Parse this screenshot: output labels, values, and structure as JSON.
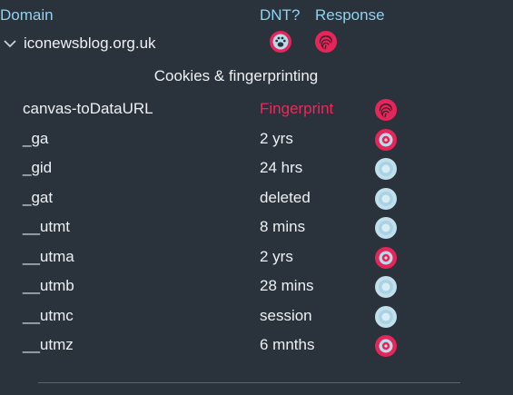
{
  "header": {
    "domain_label": "Domain",
    "dnt_label": "DNT?",
    "response_label": "Response"
  },
  "domain": {
    "name": "iconewsblog.org.uk",
    "dnt_icon": "paw-icon",
    "response_icon": "fingerprint-icon"
  },
  "section": {
    "title": "Cookies & fingerprinting"
  },
  "colors": {
    "background": "#2a323c",
    "accent": "#8ed3ef",
    "fingerprint": "#ea2a5c",
    "blocked": "#e6255a",
    "allowed": "#b8dce9"
  },
  "cookies": [
    {
      "name": "canvas-toDataURL",
      "value": "Fingerprint",
      "status": "fingerprint"
    },
    {
      "name": "_ga",
      "value": "2 yrs",
      "status": "blocked"
    },
    {
      "name": "_gid",
      "value": "24 hrs",
      "status": "allowed"
    },
    {
      "name": "_gat",
      "value": "deleted",
      "status": "allowed"
    },
    {
      "name": "__utmt",
      "value": "8 mins",
      "status": "allowed"
    },
    {
      "name": "__utma",
      "value": "2 yrs",
      "status": "blocked"
    },
    {
      "name": "__utmb",
      "value": "28 mins",
      "status": "allowed"
    },
    {
      "name": "__utmc",
      "value": "session",
      "status": "allowed"
    },
    {
      "name": "__utmz",
      "value": "6 mnths",
      "status": "blocked"
    }
  ]
}
